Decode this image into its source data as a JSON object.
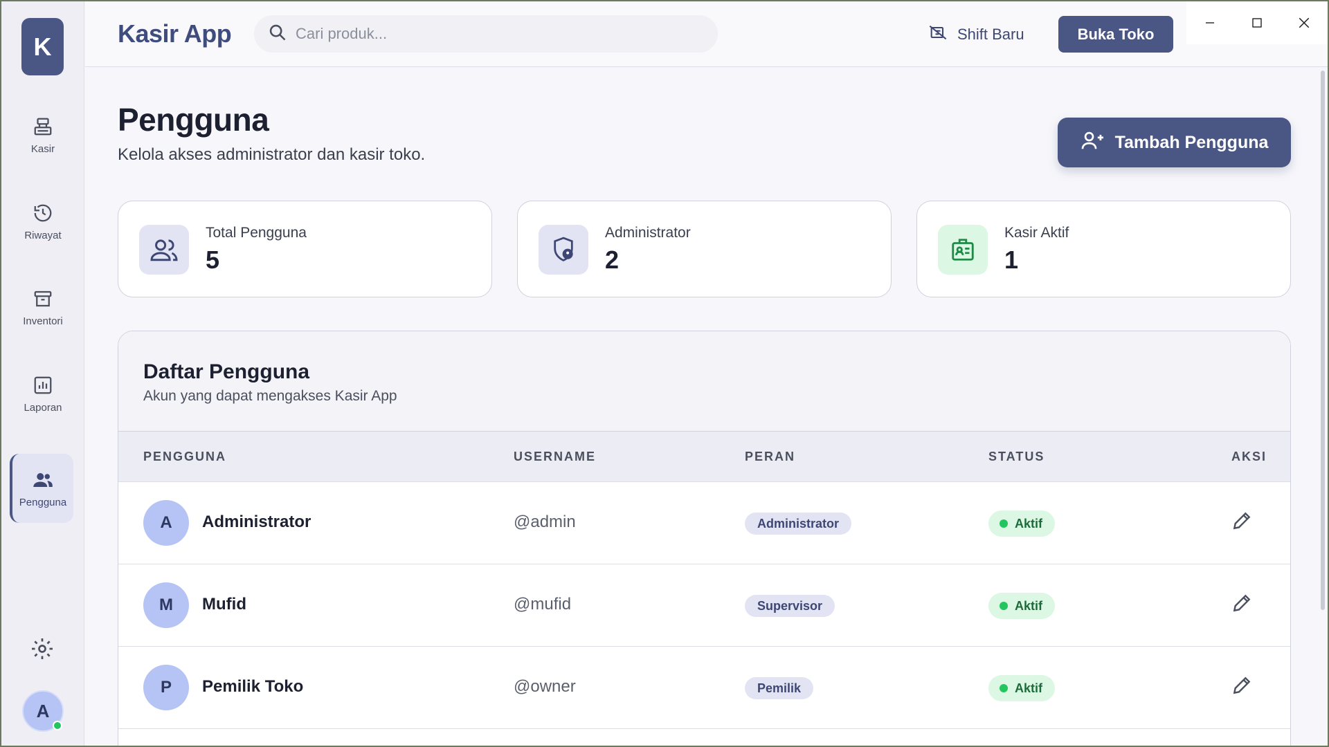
{
  "sidebar": {
    "logo": "K",
    "items": [
      {
        "label": "Kasir",
        "icon": "cash-register-icon"
      },
      {
        "label": "Riwayat",
        "icon": "history-icon"
      },
      {
        "label": "Inventori",
        "icon": "archive-box-icon"
      },
      {
        "label": "Laporan",
        "icon": "bar-chart-icon"
      },
      {
        "label": "Pengguna",
        "icon": "users-icon",
        "active": true
      }
    ],
    "avatar_initial": "A"
  },
  "topbar": {
    "app_title": "Kasir App",
    "search_placeholder": "Cari produk...",
    "shift_label": "Shift Baru",
    "open_store_label": "Buka Toko"
  },
  "page": {
    "title": "Pengguna",
    "subtitle": "Kelola akses administrator dan kasir toko.",
    "add_button_label": "Tambah Pengguna"
  },
  "stats": [
    {
      "label": "Total Pengguna",
      "value": "5",
      "icon": "users-icon"
    },
    {
      "label": "Administrator",
      "value": "2",
      "icon": "shield-user-icon"
    },
    {
      "label": "Kasir Aktif",
      "value": "1",
      "icon": "id-card-icon"
    }
  ],
  "table": {
    "title": "Daftar Pengguna",
    "subtitle": "Akun yang dapat mengakses Kasir App",
    "columns": [
      "PENGGUNA",
      "USERNAME",
      "PERAN",
      "STATUS",
      "AKSI"
    ],
    "rows": [
      {
        "initial": "A",
        "name": "Administrator",
        "username": "@admin",
        "role": "Administrator",
        "status": "Aktif"
      },
      {
        "initial": "M",
        "name": "Mufid",
        "username": "@mufid",
        "role": "Supervisor",
        "status": "Aktif"
      },
      {
        "initial": "P",
        "name": "Pemilik Toko",
        "username": "@owner",
        "role": "Pemilik",
        "status": "Aktif"
      }
    ]
  },
  "colors": {
    "primary": "#4a5683",
    "status_active_bg": "#dcf7e4",
    "status_active_dot": "#22c55e"
  }
}
